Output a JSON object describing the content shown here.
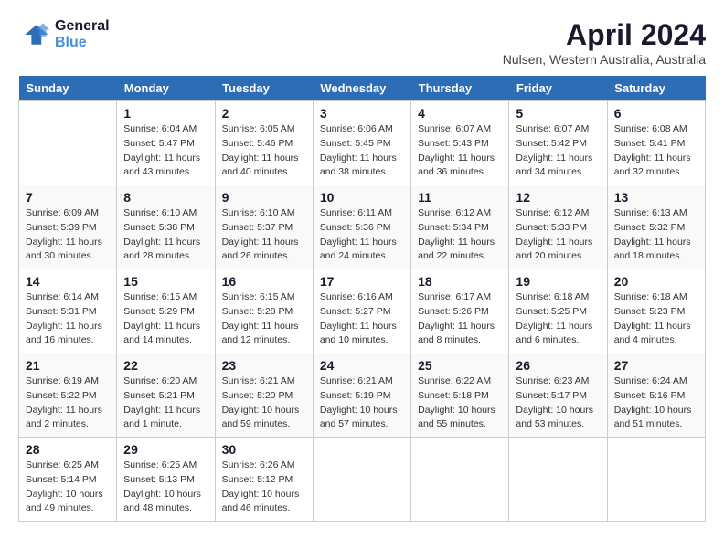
{
  "header": {
    "logo_general": "General",
    "logo_blue": "Blue",
    "title": "April 2024",
    "subtitle": "Nulsen, Western Australia, Australia"
  },
  "days_of_week": [
    "Sunday",
    "Monday",
    "Tuesday",
    "Wednesday",
    "Thursday",
    "Friday",
    "Saturday"
  ],
  "weeks": [
    [
      {
        "num": "",
        "detail": ""
      },
      {
        "num": "1",
        "detail": "Sunrise: 6:04 AM\nSunset: 5:47 PM\nDaylight: 11 hours\nand 43 minutes."
      },
      {
        "num": "2",
        "detail": "Sunrise: 6:05 AM\nSunset: 5:46 PM\nDaylight: 11 hours\nand 40 minutes."
      },
      {
        "num": "3",
        "detail": "Sunrise: 6:06 AM\nSunset: 5:45 PM\nDaylight: 11 hours\nand 38 minutes."
      },
      {
        "num": "4",
        "detail": "Sunrise: 6:07 AM\nSunset: 5:43 PM\nDaylight: 11 hours\nand 36 minutes."
      },
      {
        "num": "5",
        "detail": "Sunrise: 6:07 AM\nSunset: 5:42 PM\nDaylight: 11 hours\nand 34 minutes."
      },
      {
        "num": "6",
        "detail": "Sunrise: 6:08 AM\nSunset: 5:41 PM\nDaylight: 11 hours\nand 32 minutes."
      }
    ],
    [
      {
        "num": "7",
        "detail": "Sunrise: 6:09 AM\nSunset: 5:39 PM\nDaylight: 11 hours\nand 30 minutes."
      },
      {
        "num": "8",
        "detail": "Sunrise: 6:10 AM\nSunset: 5:38 PM\nDaylight: 11 hours\nand 28 minutes."
      },
      {
        "num": "9",
        "detail": "Sunrise: 6:10 AM\nSunset: 5:37 PM\nDaylight: 11 hours\nand 26 minutes."
      },
      {
        "num": "10",
        "detail": "Sunrise: 6:11 AM\nSunset: 5:36 PM\nDaylight: 11 hours\nand 24 minutes."
      },
      {
        "num": "11",
        "detail": "Sunrise: 6:12 AM\nSunset: 5:34 PM\nDaylight: 11 hours\nand 22 minutes."
      },
      {
        "num": "12",
        "detail": "Sunrise: 6:12 AM\nSunset: 5:33 PM\nDaylight: 11 hours\nand 20 minutes."
      },
      {
        "num": "13",
        "detail": "Sunrise: 6:13 AM\nSunset: 5:32 PM\nDaylight: 11 hours\nand 18 minutes."
      }
    ],
    [
      {
        "num": "14",
        "detail": "Sunrise: 6:14 AM\nSunset: 5:31 PM\nDaylight: 11 hours\nand 16 minutes."
      },
      {
        "num": "15",
        "detail": "Sunrise: 6:15 AM\nSunset: 5:29 PM\nDaylight: 11 hours\nand 14 minutes."
      },
      {
        "num": "16",
        "detail": "Sunrise: 6:15 AM\nSunset: 5:28 PM\nDaylight: 11 hours\nand 12 minutes."
      },
      {
        "num": "17",
        "detail": "Sunrise: 6:16 AM\nSunset: 5:27 PM\nDaylight: 11 hours\nand 10 minutes."
      },
      {
        "num": "18",
        "detail": "Sunrise: 6:17 AM\nSunset: 5:26 PM\nDaylight: 11 hours\nand 8 minutes."
      },
      {
        "num": "19",
        "detail": "Sunrise: 6:18 AM\nSunset: 5:25 PM\nDaylight: 11 hours\nand 6 minutes."
      },
      {
        "num": "20",
        "detail": "Sunrise: 6:18 AM\nSunset: 5:23 PM\nDaylight: 11 hours\nand 4 minutes."
      }
    ],
    [
      {
        "num": "21",
        "detail": "Sunrise: 6:19 AM\nSunset: 5:22 PM\nDaylight: 11 hours\nand 2 minutes."
      },
      {
        "num": "22",
        "detail": "Sunrise: 6:20 AM\nSunset: 5:21 PM\nDaylight: 11 hours\nand 1 minute."
      },
      {
        "num": "23",
        "detail": "Sunrise: 6:21 AM\nSunset: 5:20 PM\nDaylight: 10 hours\nand 59 minutes."
      },
      {
        "num": "24",
        "detail": "Sunrise: 6:21 AM\nSunset: 5:19 PM\nDaylight: 10 hours\nand 57 minutes."
      },
      {
        "num": "25",
        "detail": "Sunrise: 6:22 AM\nSunset: 5:18 PM\nDaylight: 10 hours\nand 55 minutes."
      },
      {
        "num": "26",
        "detail": "Sunrise: 6:23 AM\nSunset: 5:17 PM\nDaylight: 10 hours\nand 53 minutes."
      },
      {
        "num": "27",
        "detail": "Sunrise: 6:24 AM\nSunset: 5:16 PM\nDaylight: 10 hours\nand 51 minutes."
      }
    ],
    [
      {
        "num": "28",
        "detail": "Sunrise: 6:25 AM\nSunset: 5:14 PM\nDaylight: 10 hours\nand 49 minutes."
      },
      {
        "num": "29",
        "detail": "Sunrise: 6:25 AM\nSunset: 5:13 PM\nDaylight: 10 hours\nand 48 minutes."
      },
      {
        "num": "30",
        "detail": "Sunrise: 6:26 AM\nSunset: 5:12 PM\nDaylight: 10 hours\nand 46 minutes."
      },
      {
        "num": "",
        "detail": ""
      },
      {
        "num": "",
        "detail": ""
      },
      {
        "num": "",
        "detail": ""
      },
      {
        "num": "",
        "detail": ""
      }
    ]
  ]
}
